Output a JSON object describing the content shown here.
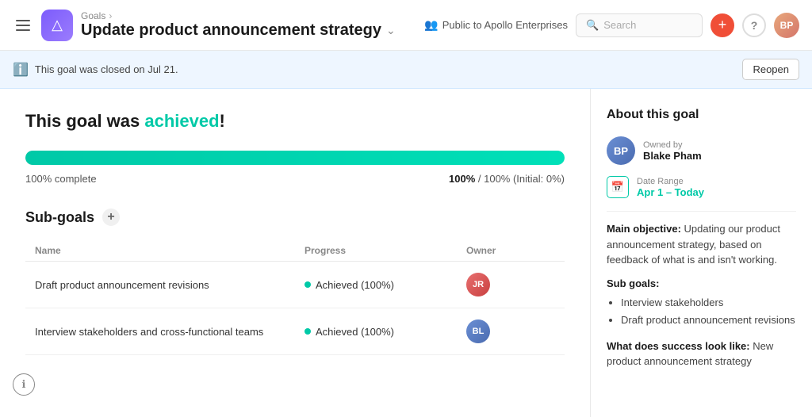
{
  "header": {
    "menu_icon": "≡",
    "app_icon": "△",
    "breadcrumb": "Goals",
    "breadcrumb_arrow": "›",
    "title": "Update product announcement strategy",
    "chevron": "⌄",
    "visibility": "Public to Apollo Enterprises",
    "search_placeholder": "Search",
    "add_btn_label": "+",
    "help_label": "?",
    "avatar_label": "BP"
  },
  "notification": {
    "text": "This goal was closed on Jul 21.",
    "reopen_label": "Reopen"
  },
  "content": {
    "status_title_prefix": "This goal was ",
    "status_word": "achieved",
    "status_title_suffix": "!",
    "progress_percent": 100,
    "progress_label_left": "100% complete",
    "progress_label_right_bold": "100%",
    "progress_label_right": "/ 100% (Initial: 0%)",
    "subgoals_title": "Sub-goals",
    "add_icon": "+",
    "table_columns": {
      "name": "Name",
      "progress": "Progress",
      "owner": "Owner"
    },
    "subgoals": [
      {
        "name": "Draft product announcement revisions",
        "progress": "Achieved (100%)",
        "owner_initials": "JR",
        "owner_color": "red"
      },
      {
        "name": "Interview stakeholders and cross-functional teams",
        "progress": "Achieved (100%)",
        "owner_initials": "BL",
        "owner_color": "blue"
      }
    ]
  },
  "sidebar": {
    "title": "About this goal",
    "owner_label": "Owned by",
    "owner_name": "Blake Pham",
    "date_label": "Date Range",
    "date_value": "Apr 1 – Today",
    "main_objective_label": "Main objective:",
    "main_objective_text": "Updating our product announcement strategy, based on feedback of what is and isn't working.",
    "sub_goals_label": "Sub goals:",
    "sub_goals_items": [
      "Interview stakeholders",
      "Draft product announcement revisions"
    ],
    "success_label": "What does success look like:",
    "success_text": "New product announcement strategy"
  }
}
